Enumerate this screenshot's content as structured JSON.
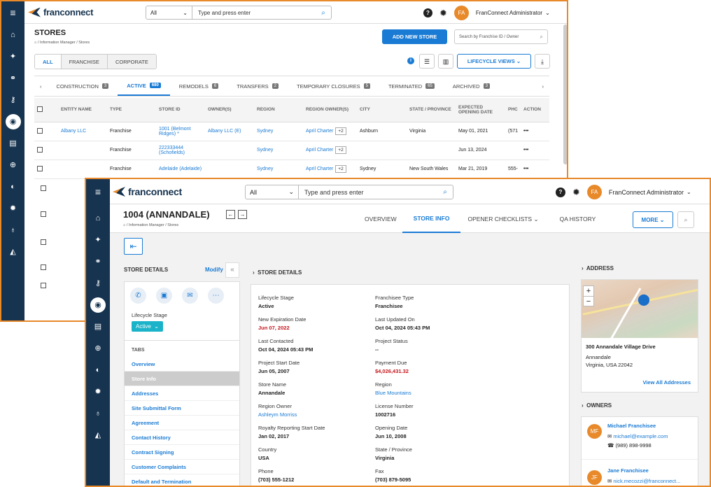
{
  "back": {
    "app": {
      "logo": "franconnect",
      "search_scope": "All",
      "search_placeholder": "Type and press enter",
      "user_initials": "FA",
      "user_name": "FranConnect Administrator",
      "help": "?"
    },
    "page_title": "STORES",
    "breadcrumb": "/ Information Manager / Stores",
    "add_button": "ADD NEW STORE",
    "store_search_placeholder": "Search by Franchise ID / Owner",
    "filters": [
      "ALL",
      "FRANCHISE",
      "CORPORATE"
    ],
    "lifecycle_views": "LIFECYCLE VIEWS",
    "status_tabs": [
      {
        "label": "CONSTRUCTION",
        "count": "3"
      },
      {
        "label": "ACTIVE",
        "count": "680"
      },
      {
        "label": "REMODELS",
        "count": "6"
      },
      {
        "label": "TRANSFERS",
        "count": "2"
      },
      {
        "label": "TEMPORARY CLOSURES",
        "count": "5"
      },
      {
        "label": "TERMINATED",
        "count": "65"
      },
      {
        "label": "ARCHIVED",
        "count": "3"
      }
    ],
    "columns": [
      "ENTITY NAME",
      "TYPE",
      "STORE ID",
      "OWNER(S)",
      "REGION",
      "REGION OWNER(S)",
      "CITY",
      "STATE / PROVINCE",
      "EXPECTED OPENING DATE",
      "PHC",
      "ACTION"
    ],
    "rows": [
      {
        "entity": "Albany LLC",
        "type": "Franchise",
        "store_id": "1001 (Belmont Ridges) *",
        "owner": "Albany LLC (E)",
        "region": "Sydney",
        "region_owner": "April Charter",
        "more": "+2",
        "city": "Ashburn",
        "state": "Virginia",
        "date": "May 01, 2021",
        "phone": "(571",
        "action": "•••"
      },
      {
        "entity": "",
        "type": "Franchise",
        "store_id": "222333444 (Schofields)",
        "owner": "",
        "region": "Sydney",
        "region_owner": "April Charter",
        "more": "+2",
        "city": "",
        "state": "",
        "date": "Jun 13, 2024",
        "phone": "",
        "action": "•••"
      },
      {
        "entity": "",
        "type": "Franchise",
        "store_id": "Adelaide (Adelaide)",
        "owner": "",
        "region": "Sydney",
        "region_owner": "April Charter",
        "more": "+2",
        "city": "Sydney",
        "state": "New South Wales",
        "date": "Mar 21, 2019",
        "phone": "555-",
        "action": "•••"
      }
    ]
  },
  "front": {
    "title": "1004 (ANNANDALE)",
    "breadcrumb": "/ Information Manager / Stores",
    "nav": [
      "OVERVIEW",
      "STORE INFO",
      "OPENER CHECKLISTS",
      "QA HISTORY"
    ],
    "more": "MORE",
    "left": {
      "header": "STORE DETAILS",
      "modify": "Modify",
      "lifecycle_label": "Lifecycle Stage",
      "lifecycle_value": "Active",
      "tabs_label": "TABS",
      "tabs": [
        "Overview",
        "Store Info",
        "Addresses",
        "Site Submittal Form",
        "Agreement",
        "Contact History",
        "Contract Signing",
        "Customer Complaints",
        "Default and Termination"
      ]
    },
    "details": {
      "header": "STORE DETAILS",
      "fields": [
        {
          "label": "Lifecycle Stage",
          "value": "Active",
          "style": "bold"
        },
        {
          "label": "Franchisee Type",
          "value": "Franchisee",
          "style": "bold"
        },
        {
          "label": "New Expiration Date",
          "value": "Jun 07, 2022",
          "style": "red"
        },
        {
          "label": "Last Updated On",
          "value": "Oct 04, 2024 05:43 PM",
          "style": "bold"
        },
        {
          "label": "Last Contacted",
          "value": "Oct 04, 2024 05:43 PM",
          "style": "bold"
        },
        {
          "label": "Project Status",
          "value": "--",
          "style": "bold"
        },
        {
          "label": "Project Start Date",
          "value": "Jun 05, 2007",
          "style": "bold"
        },
        {
          "label": "Payment Due",
          "value": "$4,026,431.32",
          "style": "red"
        },
        {
          "label": "Store Name",
          "value": "Annandale",
          "style": "bold"
        },
        {
          "label": "Region",
          "value": "Blue Mountains",
          "style": "link"
        },
        {
          "label": "Region Owner",
          "value": "Ashleym Morriss",
          "style": "link"
        },
        {
          "label": "License Number",
          "value": "1002716",
          "style": "bold"
        },
        {
          "label": "Royalty Reporting Start Date",
          "value": "Jan 02, 2017",
          "style": "bold"
        },
        {
          "label": "Opening Date",
          "value": "Jun 10, 2008",
          "style": "bold"
        },
        {
          "label": "Country",
          "value": "USA",
          "style": "bold"
        },
        {
          "label": "State / Province",
          "value": "Virginia",
          "style": "bold"
        },
        {
          "label": "Phone",
          "value": "(703) 555-1212",
          "style": "bold"
        },
        {
          "label": "Fax",
          "value": "(703) 879-5095",
          "style": "bold"
        }
      ]
    },
    "address": {
      "header": "ADDRESS",
      "line1": "300 Annandale Village Drive",
      "line2": "Annandale",
      "line3": "Virginia, USA 22042",
      "view_all": "View All Addresses",
      "map_zoom_in": "+",
      "map_zoom_out": "−"
    },
    "owners": {
      "header": "OWNERS",
      "list": [
        {
          "initials": "MF",
          "name": "Michael Franchisee",
          "email": "michael@example.com",
          "phone": "(989) 898-9998"
        },
        {
          "initials": "JF",
          "name": "Jane Franchisee",
          "email": "nick.mecozzi@franconnect...",
          "phone": ""
        }
      ]
    }
  },
  "colors": {
    "accent": "#1a7bd4",
    "sidebar": "#16334f",
    "orange": "#e8892a",
    "red": "#c4161c"
  }
}
